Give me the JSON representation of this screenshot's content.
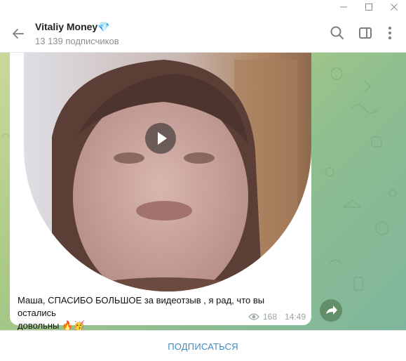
{
  "window": {
    "minimize_icon": "minimize-icon",
    "maximize_icon": "maximize-icon",
    "close_icon": "close-icon"
  },
  "header": {
    "title": "Vitaliy Money",
    "title_emoji": "💎",
    "subtitle": "13 139 подписчиков"
  },
  "message": {
    "caption_line1": "Маша, СПАСИБО БОЛЬШОЕ за видеотзыв , я рад, что вы остались",
    "caption_line2": "довольны",
    "caption_emojis": "🔥🥳",
    "views": "168",
    "time": "14:49"
  },
  "footer": {
    "subscribe_label": "ПОДПИСАТЬСЯ"
  },
  "colors": {
    "accent": "#3a8cc7",
    "chat_bg": "#a9c985"
  }
}
